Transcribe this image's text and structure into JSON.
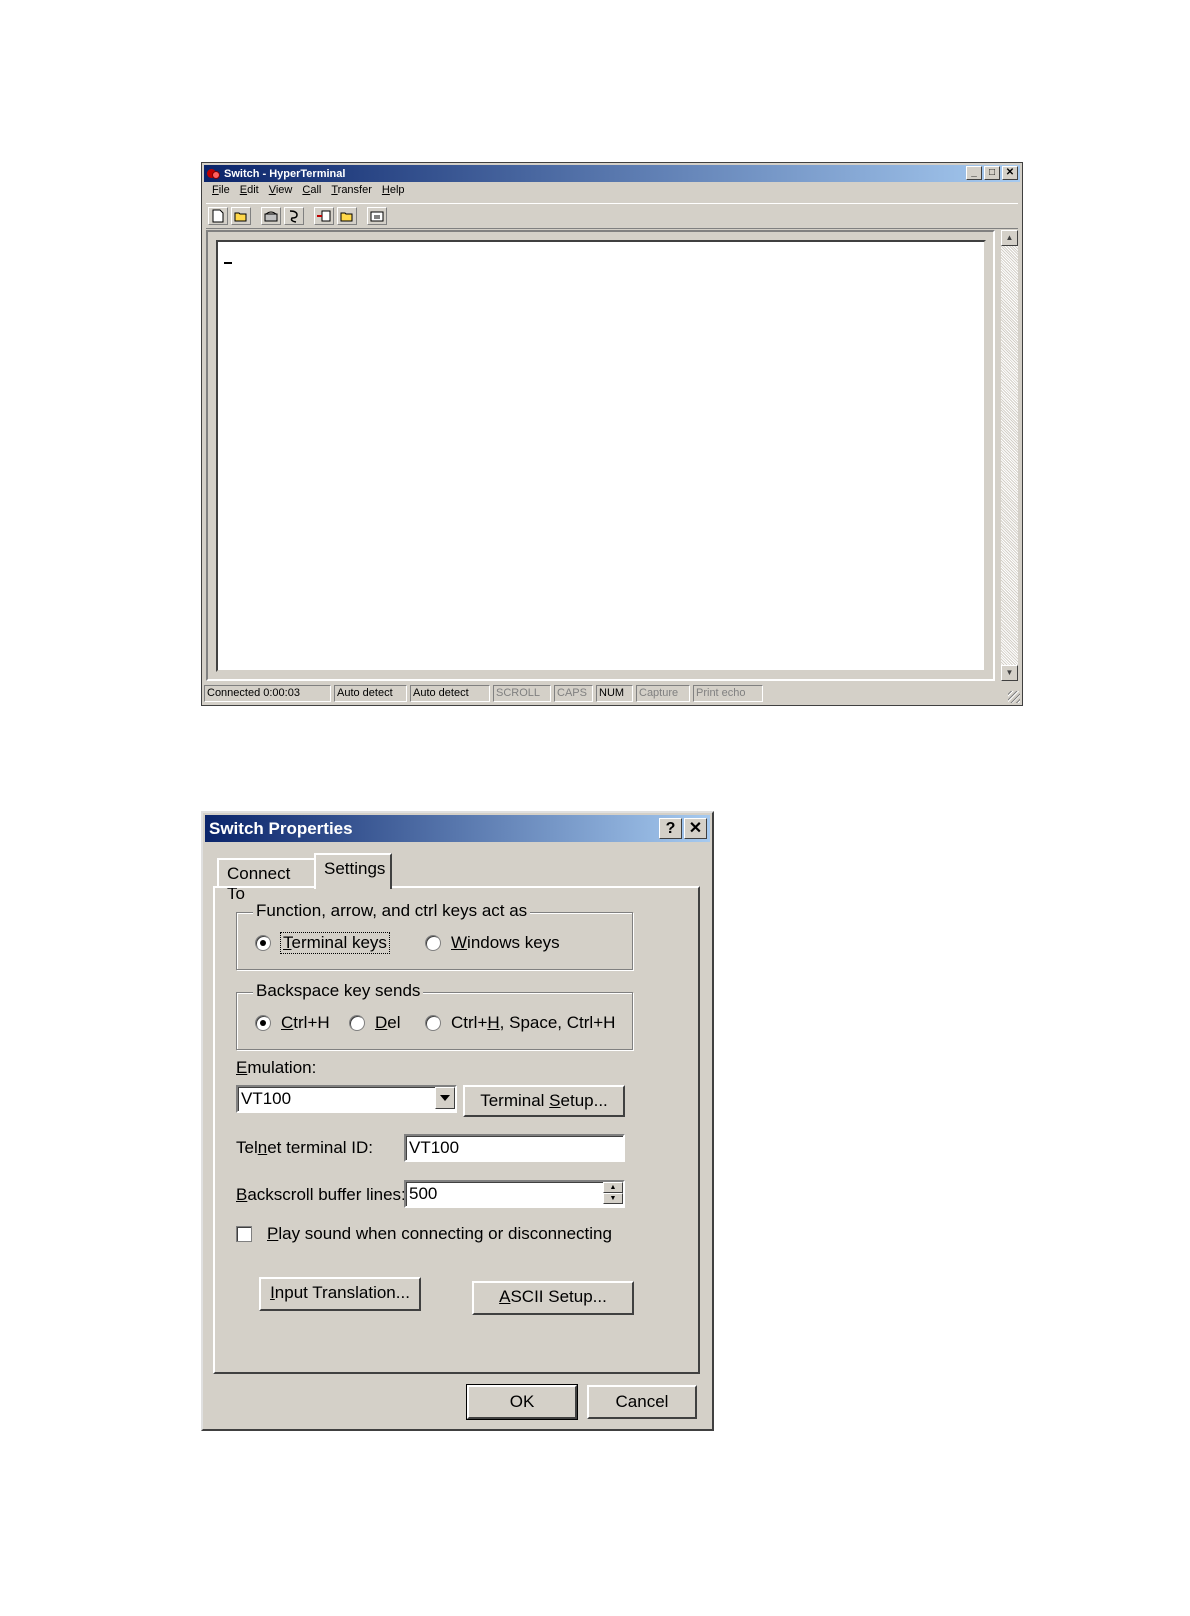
{
  "hyperterminal": {
    "title": "Switch - HyperTerminal",
    "window_buttons": [
      "_",
      "□",
      "✕"
    ],
    "menu": [
      {
        "label": "File",
        "mnemonic": "F",
        "rest": "ile"
      },
      {
        "label": "Edit",
        "mnemonic": "E",
        "rest": "dit"
      },
      {
        "label": "View",
        "mnemonic": "V",
        "rest": "iew"
      },
      {
        "label": "Call",
        "mnemonic": "C",
        "rest": "all"
      },
      {
        "label": "Transfer",
        "mnemonic": "T",
        "rest": "ransfer"
      },
      {
        "label": "Help",
        "mnemonic": "H",
        "rest": "elp"
      }
    ],
    "toolbar_icons": [
      "new-icon",
      "open-icon",
      "connect-icon",
      "disconnect-icon",
      "send-icon",
      "receive-icon",
      "properties-icon"
    ],
    "status": {
      "connected": "Connected 0:00:03",
      "auto_detect_1": "Auto detect",
      "auto_detect_2": "Auto detect",
      "scroll": "SCROLL",
      "caps": "CAPS",
      "num": "NUM",
      "capture": "Capture",
      "print_echo": "Print echo"
    }
  },
  "dialog": {
    "title": "Switch Properties",
    "help_button": "?",
    "close_button": "✕",
    "tabs": {
      "connect_to": "Connect To",
      "settings": "Settings"
    },
    "keys_group": {
      "legend": "Function, arrow, and ctrl keys act as",
      "terminal_keys": {
        "mn": "T",
        "rest": "erminal keys"
      },
      "windows_keys": {
        "mn": "W",
        "rest": "indows keys"
      },
      "selected": "terminal_keys"
    },
    "backspace_group": {
      "legend": "Backspace key sends",
      "ctrl_h": {
        "mn": "C",
        "rest": "trl+H"
      },
      "del": {
        "mn": "D",
        "rest": "el"
      },
      "ctrl_h_space": {
        "pre": "Ctrl+",
        "mn": "H",
        "rest": ", Space, Ctrl+H"
      },
      "selected": "ctrl_h"
    },
    "emulation": {
      "label_mn": "E",
      "label_rest": "mulation:",
      "value": "VT100"
    },
    "terminal_setup": {
      "pre": "Terminal ",
      "mn": "S",
      "rest": "etup..."
    },
    "telnet": {
      "label_pre": "Tel",
      "label_mn": "n",
      "label_rest": "et terminal ID:",
      "value": "VT100"
    },
    "backscroll": {
      "label_mn": "B",
      "label_rest": "ackscroll buffer lines:",
      "value": "500"
    },
    "play_sound": {
      "mn": "P",
      "rest": "lay sound when connecting or disconnecting",
      "checked": false
    },
    "input_translation": {
      "mn": "I",
      "rest": "nput Translation..."
    },
    "ascii_setup": {
      "mn": "A",
      "rest": "SCII Setup..."
    },
    "ok": "OK",
    "cancel": "Cancel"
  }
}
